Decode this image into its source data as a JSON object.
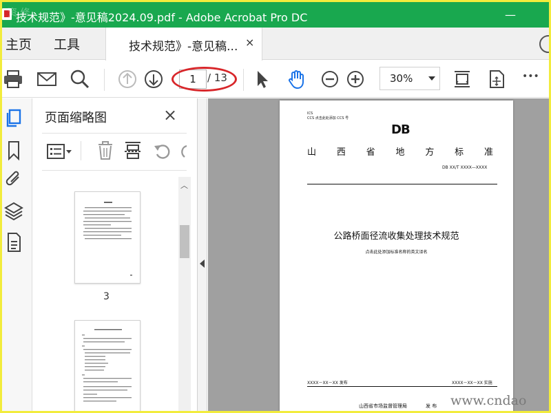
{
  "window": {
    "title": "技术规范》-意见稿2024.09.pdf - Adobe Acrobat Pro DC",
    "minimize_glyph": "—",
    "watermark_logo": "资 修"
  },
  "menu": {
    "home": "主页",
    "tools": "工具"
  },
  "doc_tab": {
    "label": "技术规范》-意见稿...",
    "close_glyph": "×"
  },
  "toolbar": {
    "current_page": "1",
    "total_pages": "/ 13",
    "zoom": "30%",
    "more_glyph": "•••"
  },
  "thumbnails": {
    "title": "页面缩略图",
    "close_glyph": "×",
    "visible_pages": [
      {
        "number": "3"
      }
    ]
  },
  "document_page": {
    "ics": "ICS",
    "ccs": "CCS  点击此处添加 CCS 号",
    "logo": "DB",
    "standard_type": [
      "山",
      "西",
      "省",
      "地",
      "方",
      "标",
      "准"
    ],
    "doc_number": "DB XX/T  XXXX—XXXX",
    "title": "公路桥面径流收集处理技术规范",
    "english_title_placeholder": "点击此处添加标准名称的英文译名",
    "publish_date": "XXXX－XX－XX 发布",
    "effective_date": "XXXX－XX－XX 实施",
    "issuer": "山西省市场监督管理局",
    "issue_word": "发  布"
  },
  "site_watermark": "www.cndao",
  "icons": {
    "print": "print-icon",
    "mail": "mail-icon",
    "search": "search-icon",
    "prev_page": "arrow-up-circle-icon",
    "next_page": "arrow-down-circle-icon",
    "select": "cursor-arrow-icon",
    "hand": "hand-icon",
    "zoom_out": "minus-circle-icon",
    "zoom_in": "plus-circle-icon"
  },
  "colors": {
    "titlebar": "#19a84f",
    "annotation_red": "#d8262a",
    "hand_blue": "#1a73e8",
    "viewport_bg": "#a0a0a0",
    "frame_yellow": "#f2ec3c"
  }
}
